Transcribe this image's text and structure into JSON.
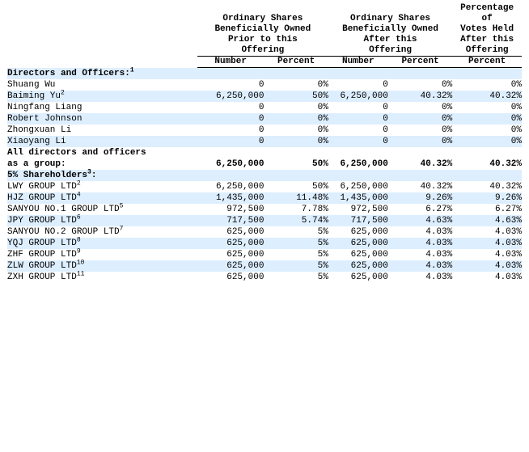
{
  "table": {
    "header_groups": [
      "",
      "Ordinary Shares Beneficially Owned Prior to this Offering",
      "Ordinary Shares Beneficially Owned After this Offering",
      "Percentage of Votes Held After this Offering"
    ],
    "header_groups_lines": {
      "g1": [
        "Ordinary Shares",
        "Beneficially Owned",
        "Prior to this",
        "Offering"
      ],
      "g2": [
        "Ordinary Shares",
        "Beneficially Owned",
        "After this",
        "Offering"
      ],
      "g3": [
        "Percentage",
        "of",
        "Votes Held",
        "After this",
        "Offering"
      ]
    },
    "subheaders": [
      "Number",
      "Percent",
      "Number",
      "Percent",
      "Percent"
    ],
    "sections": [
      {
        "title": "Directors and Officers:",
        "title_sup": "1",
        "rows": [
          {
            "label": "Shuang Wu",
            "sup": "",
            "values": [
              "0",
              "0%",
              "0",
              "0%",
              "0%"
            ]
          },
          {
            "label": "Baiming Yu",
            "sup": "2",
            "values": [
              "6,250,000",
              "50%",
              "6,250,000",
              "40.32%",
              "40.32%"
            ]
          },
          {
            "label": "Ningfang Liang",
            "sup": "",
            "values": [
              "0",
              "0%",
              "0",
              "0%",
              "0%"
            ]
          },
          {
            "label": "Robert Johnson",
            "sup": "",
            "values": [
              "0",
              "0%",
              "0",
              "0%",
              "0%"
            ]
          },
          {
            "label": "Zhongxuan Li",
            "sup": "",
            "values": [
              "0",
              "0%",
              "0",
              "0%",
              "0%"
            ]
          },
          {
            "label": "Xiaoyang Li",
            "sup": "",
            "values": [
              "0",
              "0%",
              "0",
              "0%",
              "0%"
            ]
          }
        ]
      },
      {
        "title": "All directors and officers as a group:",
        "title_sup": "",
        "title_line1": "All directors and officers",
        "title_line2": "as a group:",
        "rows": [
          {
            "label": "",
            "sup": "",
            "values": [
              "6,250,000",
              "50%",
              "6,250,000",
              "40.32%",
              "40.32%"
            ]
          }
        ]
      },
      {
        "title": "5% Shareholders",
        "title_sup": "3",
        "title_suffix": ":",
        "rows": [
          {
            "label": "LWY GROUP LTD",
            "sup": "2",
            "values": [
              "6,250,000",
              "50%",
              "6,250,000",
              "40.32%",
              "40.32%"
            ]
          },
          {
            "label": "HJZ GROUP LTD",
            "sup": "4",
            "values": [
              "1,435,000",
              "11.48%",
              "1,435,000",
              "9.26%",
              "9.26%"
            ]
          },
          {
            "label": "SANYOU NO.1 GROUP LTD",
            "sup": "5",
            "values": [
              "972,500",
              "7.78%",
              "972,500",
              "6.27%",
              "6.27%"
            ]
          },
          {
            "label": "JPY GROUP LTD",
            "sup": "6",
            "values": [
              "717,500",
              "5.74%",
              "717,500",
              "4.63%",
              "4.63%"
            ]
          },
          {
            "label": "SANYOU NO.2 GROUP LTD",
            "sup": "7",
            "values": [
              "625,000",
              "5%",
              "625,000",
              "4.03%",
              "4.03%"
            ]
          },
          {
            "label": "YQJ GROUP LTD",
            "sup": "8",
            "values": [
              "625,000",
              "5%",
              "625,000",
              "4.03%",
              "4.03%"
            ]
          },
          {
            "label": "ZHF GROUP LTD",
            "sup": "9",
            "values": [
              "625,000",
              "5%",
              "625,000",
              "4.03%",
              "4.03%"
            ]
          },
          {
            "label": "ZLW GROUP LTD",
            "sup": "10",
            "values": [
              "625,000",
              "5%",
              "625,000",
              "4.03%",
              "4.03%"
            ]
          },
          {
            "label": "ZXH GROUP LTD",
            "sup": "11",
            "values": [
              "625,000",
              "5%",
              "625,000",
              "4.03%",
              "4.03%"
            ]
          }
        ]
      }
    ],
    "colors": {
      "shade": "#ddeeff",
      "background": "#ffffff",
      "text": "#000000",
      "rule": "#000000"
    }
  }
}
